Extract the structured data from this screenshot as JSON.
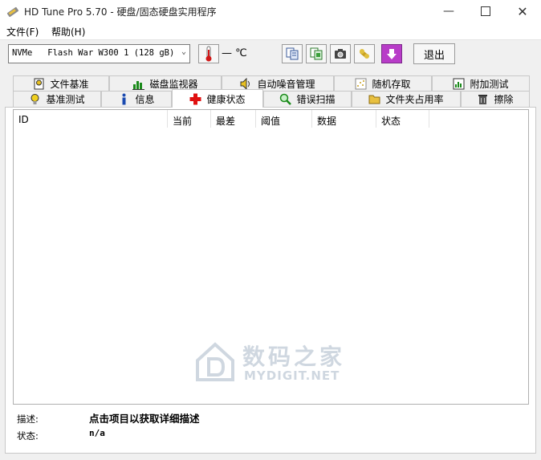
{
  "window": {
    "title": "HD Tune Pro 5.70 - 硬盘/固态硬盘实用程序"
  },
  "menu": {
    "file": "文件(F)",
    "help": "帮助(H)"
  },
  "toolbar": {
    "drive": "NVMe   Flash War W300 1 (128 gB)",
    "temperature": "— ℃",
    "exit_label": "退出"
  },
  "tabs_top": [
    "文件基准",
    "磁盘监视器",
    "自动噪音管理",
    "随机存取",
    "附加测试"
  ],
  "tabs_bottom": [
    "基准测试",
    "信息",
    "健康状态",
    "错误扫描",
    "文件夹占用率",
    "擦除"
  ],
  "active_tab": "健康状态",
  "health": {
    "columns": [
      "ID",
      "当前",
      "最差",
      "阈值",
      "数据",
      "状态"
    ],
    "rows": [],
    "description_label": "描述:",
    "description_value": "点击项目以获取详细描述",
    "status_label": "状态:",
    "status_value": "n/a"
  },
  "watermark": {
    "cn": "数码之家",
    "en": "MYDIGIT.NET"
  },
  "colors": {
    "accent_purple": "#b83cc8",
    "thermo_red": "#d01818",
    "cross_red": "#e01010"
  }
}
